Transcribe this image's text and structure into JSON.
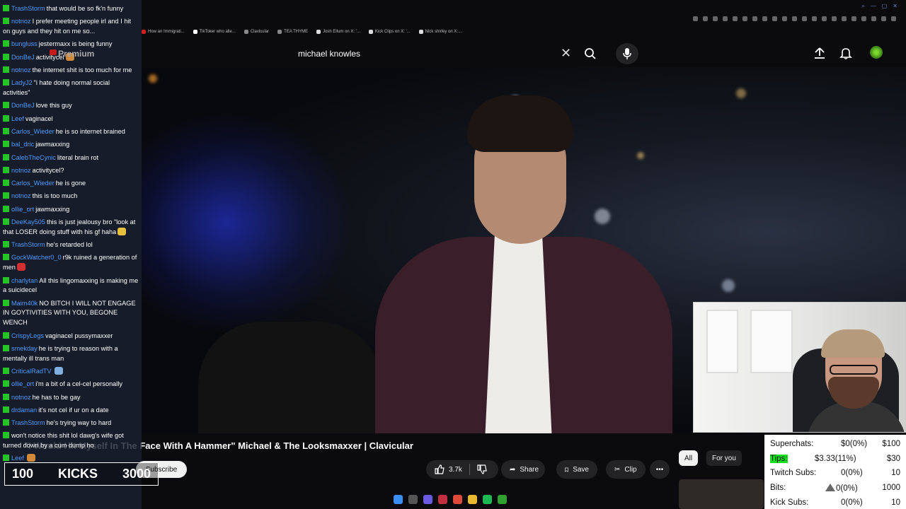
{
  "browser": {
    "bookmarks": [
      "How an Immigrati...",
      "TikToker who alle...",
      "Clavicular",
      "TEA THYME",
      "Josh Ellum on X: '...",
      "Kick Clips on X: '...",
      "Nick shirley on X:..."
    ]
  },
  "header": {
    "brand": "Premium",
    "search_value": "michael knowles"
  },
  "video": {
    "title": "\"I Would Hit Myself In The Face With A Hammer\" Michael & The Looksmaxxer | Clavicular",
    "subscribe_label": "Subscribe",
    "like_count": "3.7k",
    "share_label": "Share",
    "save_label": "Save",
    "clip_label": "Clip",
    "filters": [
      "All",
      "For you"
    ]
  },
  "chat": {
    "messages": [
      {
        "user": "TrashStorm",
        "color": "#4b9bff",
        "text": "that would be so fk'n funny"
      },
      {
        "user": "notnoz",
        "color": "#4b9bff",
        "text": "I prefer meeting people irl and I hit on guys and they hit on me so..."
      },
      {
        "user": "bungluss",
        "color": "#4b9bff",
        "text": "jestermaxx is being funny"
      },
      {
        "user": "DonBeJ",
        "color": "#4b9bff",
        "text": "activitycel",
        "emote": "#d08a3a"
      },
      {
        "user": "notnoz",
        "color": "#4b9bff",
        "text": "the internet shit is too much for me"
      },
      {
        "user": "LadyJ2",
        "color": "#4b9bff",
        "text": "\"i hate doing normal social activities\""
      },
      {
        "user": "DonBeJ",
        "color": "#4b9bff",
        "text": "love this guy"
      },
      {
        "user": "Leef",
        "color": "#4b9bff",
        "text": "vaginacel"
      },
      {
        "user": "Carlos_Wieder",
        "color": "#4b9bff",
        "text": "he is so internet brained"
      },
      {
        "user": "bal_dric",
        "color": "#4b9bff",
        "text": "jawmaxxing"
      },
      {
        "user": "CalebTheCynic",
        "color": "#4b9bff",
        "text": "literal brain rot"
      },
      {
        "user": "notnoz",
        "color": "#4b9bff",
        "text": "activitycel?"
      },
      {
        "user": "Carlos_Wieder",
        "color": "#4b9bff",
        "text": "he is gone"
      },
      {
        "user": "notnoz",
        "color": "#4b9bff",
        "text": "this is too much"
      },
      {
        "user": "ollie_ort",
        "color": "#4b9bff",
        "text": "jawmaxxing"
      },
      {
        "user": "DeeKay505",
        "color": "#4b9bff",
        "text": "this is just jealousy bro \"look at that LOSER doing stuff with his gf haha",
        "emote": "#e8c040"
      },
      {
        "user": "TrashStorm",
        "color": "#4b9bff",
        "text": "he's retarded lol"
      },
      {
        "user": "GockWatcher0_0",
        "color": "#4b9bff",
        "text": "r9k ruined a generation of men",
        "emote": "#d03030"
      },
      {
        "user": "charlytan",
        "color": "#4b9bff",
        "text": "All this lingomaxxing is making me a suicidecel"
      },
      {
        "user": "Maim40k",
        "color": "#4b9bff",
        "text": "NO BITCH I WILL NOT ENGAGE IN GOYTIVITIES WITH YOU, BEGONE WENCH"
      },
      {
        "user": "CrispyLegs",
        "color": "#4b9bff",
        "text": "vaginacel pussymaxxer"
      },
      {
        "user": "smekday",
        "color": "#4b9bff",
        "text": "he is trying to reason with a mentally ill trans man"
      },
      {
        "user": "CriticalRadTV",
        "color": "#4b9bff",
        "text": "",
        "emote": "#7fb0e0"
      },
      {
        "user": "ollie_ort",
        "color": "#4b9bff",
        "text": "i'm a bit of a cel-cel personally"
      },
      {
        "user": "notnoz",
        "color": "#4b9bff",
        "text": "he has to be gay"
      },
      {
        "user": "drdaman",
        "color": "#4b9bff",
        "text": "it's not cel if ur on a date"
      },
      {
        "user": "TrashStorm",
        "color": "#4b9bff",
        "text": "he's trying way to hard"
      },
      {
        "user": "",
        "color": "#4b9bff",
        "text": "won't notice this shit lol dawg's wife got turned down by a cum dump ho"
      },
      {
        "user": "Leef",
        "color": "#4b9bff",
        "text": "",
        "emote": "#d08a3a"
      }
    ]
  },
  "kicks": {
    "left": "100",
    "label": "KICKS",
    "right": "3000"
  },
  "stats": {
    "rows": [
      {
        "label": "Superchats:",
        "value": "$0(0%)",
        "goal": "$100"
      },
      {
        "label": "Tips:",
        "value": "$3.33(11%)",
        "goal": "$30",
        "highlight": true
      },
      {
        "label": "Twitch Subs:",
        "value": "0(0%)",
        "goal": "10"
      },
      {
        "label": "Bits:",
        "value": "0(0%)",
        "goal": "1000",
        "triangle": true
      },
      {
        "label": "Kick Subs:",
        "value": "0(0%)",
        "goal": "10"
      }
    ]
  },
  "colors": {
    "kick_green": "#23c423",
    "highlight_green": "#15e01e",
    "chat_user": "#4b9bff"
  }
}
